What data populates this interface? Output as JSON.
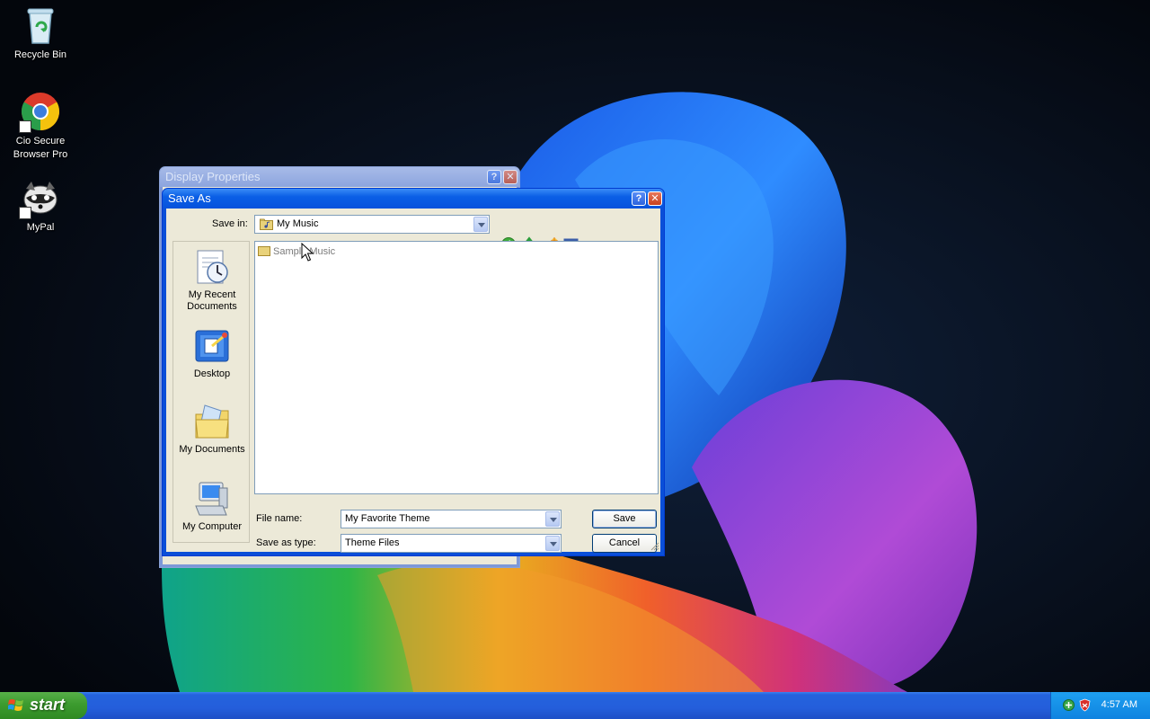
{
  "desktop": {
    "icons": [
      {
        "label": "Recycle Bin"
      },
      {
        "label": "Cio Secure Browser Pro"
      },
      {
        "label": "MyPal"
      }
    ]
  },
  "background_window": {
    "title": "Display Properties",
    "help": "?",
    "close": "✕"
  },
  "dialog": {
    "title": "Save As",
    "help": "?",
    "close": "✕",
    "save_in_label": "Save in:",
    "save_in_value": "My Music",
    "places": [
      {
        "label": "My Recent Documents"
      },
      {
        "label": "Desktop"
      },
      {
        "label": "My Documents"
      },
      {
        "label": "My Computer"
      }
    ],
    "files": [
      {
        "name": "Sample Music"
      }
    ],
    "file_name_label": "File name:",
    "file_name_value": "My Favorite Theme",
    "save_as_type_label": "Save as type:",
    "save_as_type_value": "Theme Files",
    "save_button": "Save",
    "cancel_button": "Cancel"
  },
  "taskbar": {
    "start_label": "start",
    "clock": "4:57 AM"
  }
}
